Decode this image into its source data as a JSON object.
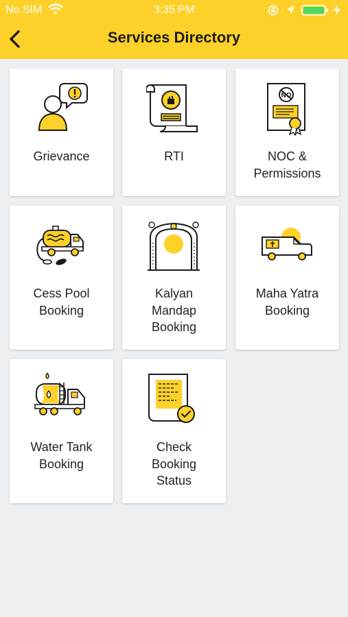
{
  "status": {
    "carrier": "No SIM",
    "time": "3:35 PM"
  },
  "header": {
    "title": "Services Directory"
  },
  "services": [
    {
      "label": "Grievance",
      "icon": "grievance-icon"
    },
    {
      "label": "RTI",
      "icon": "rti-scroll-icon"
    },
    {
      "label": "NOC &\nPermissions",
      "icon": "noc-certificate-icon"
    },
    {
      "label": "Cess Pool\nBooking",
      "icon": "cess-pool-truck-icon"
    },
    {
      "label": "Kalyan\nMandap\nBooking",
      "icon": "kalyan-mandap-icon"
    },
    {
      "label": "Maha Yatra\nBooking",
      "icon": "hearse-van-icon"
    },
    {
      "label": "Water Tank\nBooking",
      "icon": "water-tanker-icon"
    },
    {
      "label": "Check\nBooking\nStatus",
      "icon": "booking-status-icon"
    }
  ],
  "colors": {
    "accent": "#fdd129",
    "background": "#edf0f3",
    "icon_stroke": "#1a1a1a",
    "icon_fill": "#fdd129"
  }
}
